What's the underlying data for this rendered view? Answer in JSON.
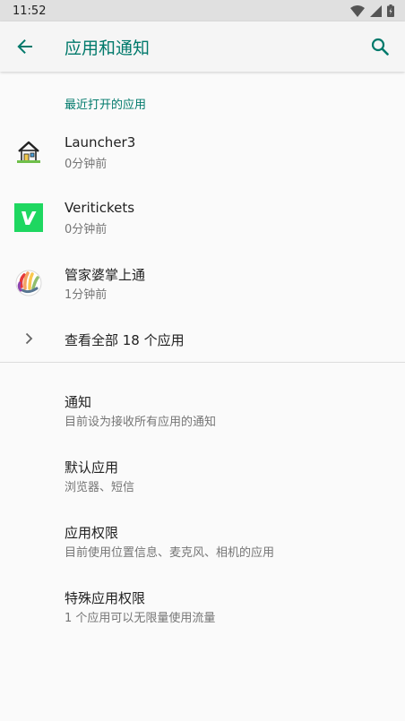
{
  "status_bar": {
    "time": "11:52",
    "icons": [
      "wifi-icon",
      "signal-icon",
      "battery-icon"
    ]
  },
  "app_bar": {
    "title": "应用和通知",
    "back_icon": "arrow-back-icon",
    "search_icon": "search-icon"
  },
  "recent_apps": {
    "header": "最近打开的应用",
    "items": [
      {
        "name": "Launcher3",
        "time": "0分钟前",
        "icon": "launcher-house-icon"
      },
      {
        "name": "Veritickets",
        "time": "0分钟前",
        "icon": "veritickets-icon"
      },
      {
        "name": "管家婆掌上通",
        "time": "1分钟前",
        "icon": "hand-logo-icon"
      }
    ],
    "see_all": "查看全部 18 个应用"
  },
  "settings": [
    {
      "title": "通知",
      "subtitle": "目前设为接收所有应用的通知"
    },
    {
      "title": "默认应用",
      "subtitle": "浏览器、短信"
    },
    {
      "title": "应用权限",
      "subtitle": "目前使用位置信息、麦克风、相机的应用"
    },
    {
      "title": "特殊应用权限",
      "subtitle": "1 个应用可以无限量使用流量"
    }
  ],
  "colors": {
    "accent": "#00796b",
    "veritickets_green": "#1ed760"
  }
}
